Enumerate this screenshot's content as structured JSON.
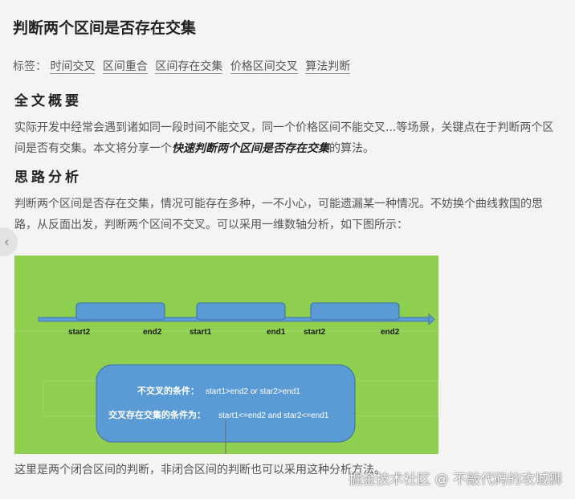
{
  "article": {
    "title": "判断两个区间是否存在交集",
    "tags_label": "标签：",
    "tags": [
      "时间交叉",
      "区间重合",
      "区间存在交集",
      "价格区间交叉",
      "算法判断"
    ],
    "section1": {
      "heading": "全文概要",
      "text_a": "实际开发中经常会遇到诸如同一段时间不能交叉，同一个价格区间不能交叉...等场景，关键点在于判断两个区间是否有交集。本文将分享一个",
      "text_bold": "快速判断两个区间是否存在交集",
      "text_b": "的算法。"
    },
    "section2": {
      "heading": "思路分析",
      "text": "判断两个区间是否存在交集，情况可能存在多种，一不小心，可能遗漏某一种情况。不妨换个曲线救国的思路，从反面出发，判断两个区间不交叉。可以采用一维数轴分析，如下图所示："
    },
    "footer_text": "这里是两个闭合区间的判断，非闭合区间的判断也可以采用这种分析方法。"
  },
  "figure": {
    "axis_labels": [
      "start2",
      "end2",
      "start1",
      "end1",
      "start2",
      "end2"
    ],
    "condition_no_overlap_label": "不交叉的条件：",
    "condition_no_overlap_expr": "start1>end2  or star2>end1",
    "condition_overlap_label": "交叉存在交集的条件为：",
    "condition_overlap_expr": "start1<=end2  and star2<=end1",
    "colors": {
      "background": "#90d050",
      "box": "#5b9bd5",
      "box_border": "#3a6ea5"
    }
  },
  "watermark": "掘金技术社区 @ 不敲代码的攻城狮",
  "nav": {
    "prev_icon": "‹"
  }
}
